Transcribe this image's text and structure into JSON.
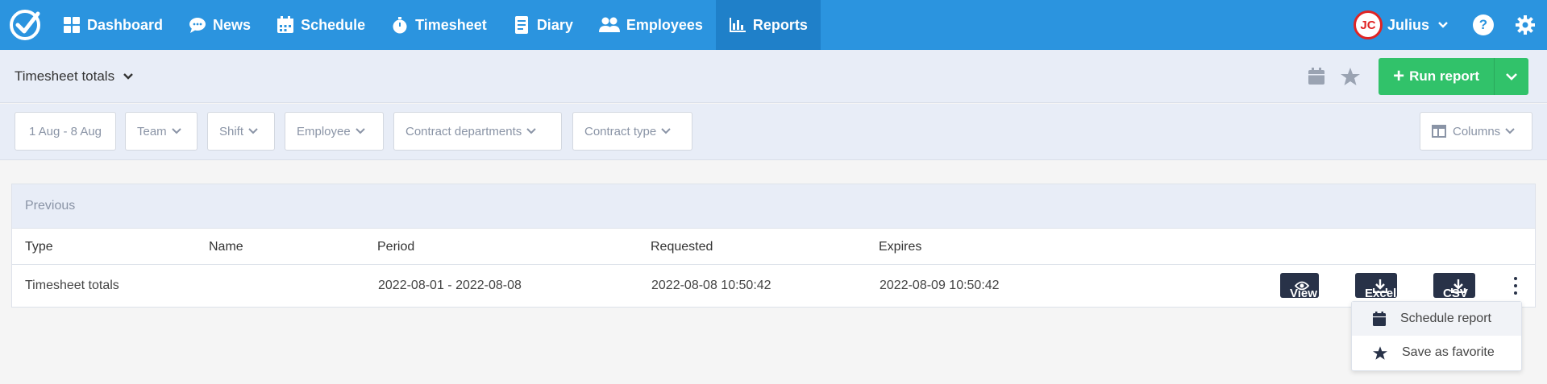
{
  "nav": {
    "items": [
      {
        "label": "Dashboard",
        "icon": "grid-icon"
      },
      {
        "label": "News",
        "icon": "chat-icon"
      },
      {
        "label": "Schedule",
        "icon": "calendar-icon"
      },
      {
        "label": "Timesheet",
        "icon": "stopwatch-icon"
      },
      {
        "label": "Diary",
        "icon": "document-icon"
      },
      {
        "label": "Employees",
        "icon": "people-icon"
      },
      {
        "label": "Reports",
        "icon": "bar-chart-icon"
      }
    ],
    "active": "Reports",
    "user": {
      "initials": "JC",
      "name": "Julius"
    },
    "help": "?"
  },
  "subheader": {
    "title": "Timesheet totals",
    "run_label": "Run report"
  },
  "filters": {
    "date": "1 Aug - 8 Aug",
    "team": "Team",
    "shift": "Shift",
    "employee": "Employee",
    "contract_departments": "Contract departments",
    "contract_type": "Contract type",
    "columns": "Columns"
  },
  "panel": {
    "title": "Previous",
    "columns": [
      "Type",
      "Name",
      "Period",
      "Requested",
      "Expires"
    ],
    "rows": [
      {
        "type": "Timesheet totals",
        "name": "",
        "period": "2022-08-01 - 2022-08-08",
        "requested": "2022-08-08 10:50:42",
        "expires": "2022-08-09 10:50:42"
      }
    ],
    "actions": {
      "view": "View",
      "excel": "Excel",
      "csv": "CSV"
    }
  },
  "menu": {
    "items": [
      {
        "label": "Schedule report",
        "icon": "calendar-icon"
      },
      {
        "label": "Save as favorite",
        "icon": "star-icon"
      }
    ]
  },
  "colors": {
    "nav_bg": "#2b94df",
    "nav_active": "#1f80c9",
    "run_green": "#31c26a",
    "action_dark": "#283248",
    "avatar_red": "#e02424"
  }
}
